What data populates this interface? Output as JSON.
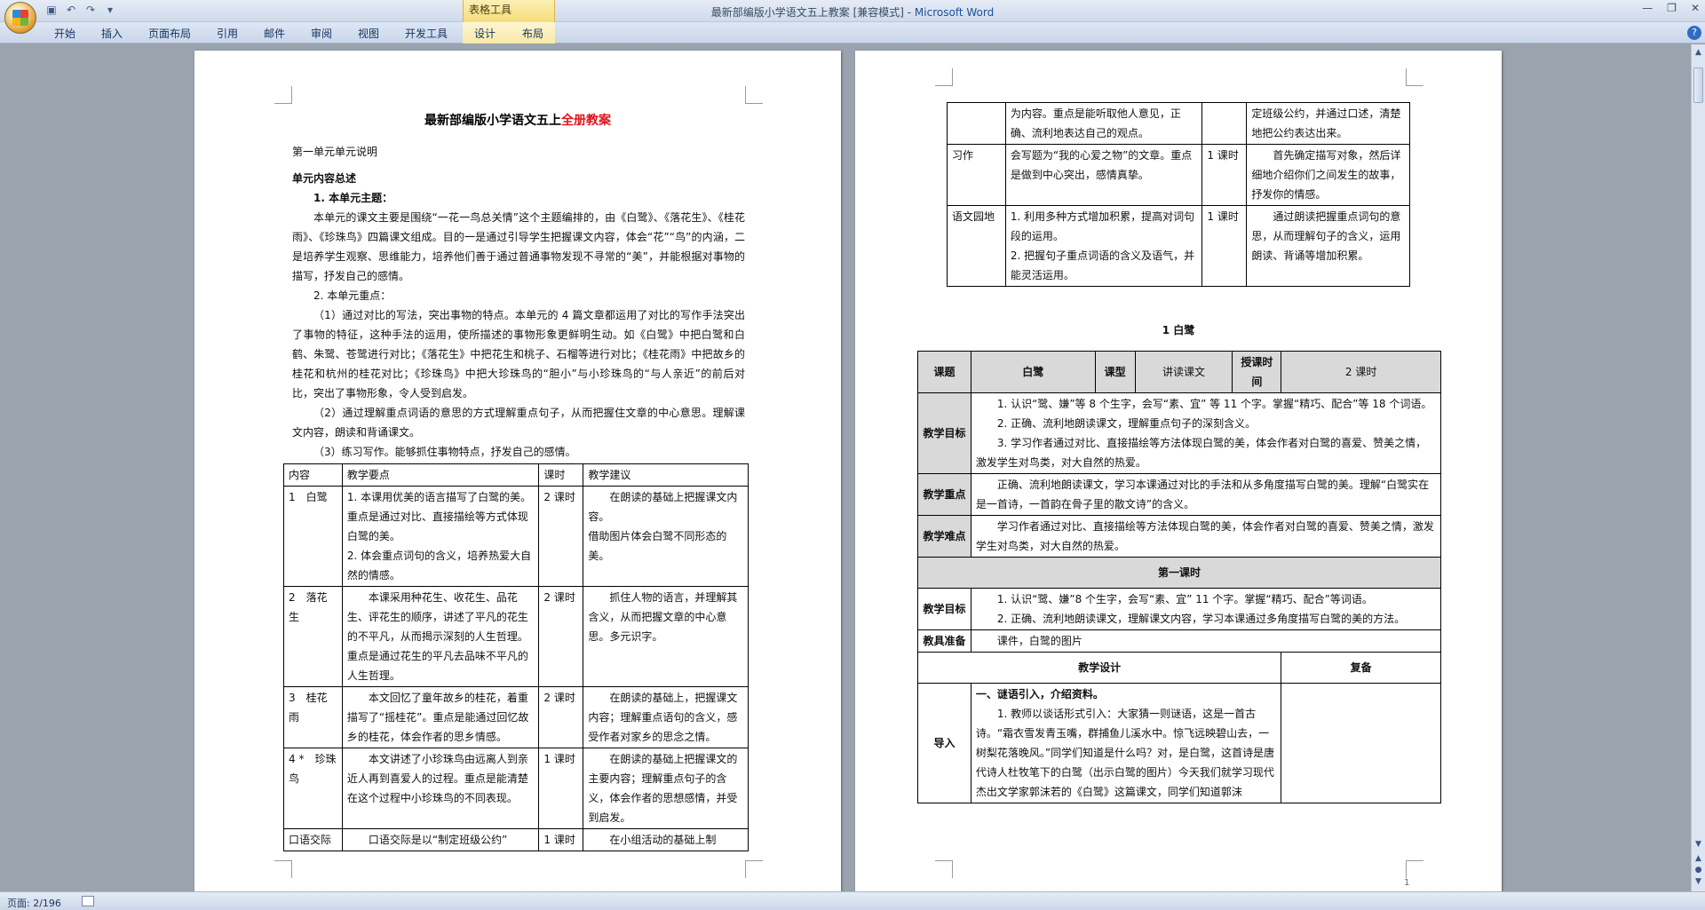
{
  "window": {
    "title_left": "最新部编版小学语文五上教案 [兼容模式] - ",
    "title_brand": "Microsoft Word",
    "context_tab_group": "表格工具"
  },
  "ribbon": {
    "tabs": [
      "开始",
      "插入",
      "页面布局",
      "引用",
      "邮件",
      "审阅",
      "视图",
      "开发工具",
      "设计",
      "布局"
    ]
  },
  "status": {
    "page": "页面: 2/196"
  },
  "page1": {
    "title_main": "最新部编版小学语文五上",
    "title_red": "全册教案",
    "unit_label": "第一单元单元说明",
    "overview_heading": "单元内容总述",
    "theme_heading": "1. 本单元主题：",
    "theme_text": "本单元的课文主要是围绕“一花一鸟总关情”这个主题编排的，由《白鹭》、《落花生》、《桂花雨》、《珍珠鸟》四篇课文组成。目的一是通过引导学生把握课文内容，体会“花”“鸟”的内涵，二是培养学生观察、思维能力，培养他们善于通过普通事物发现不寻常的“美”，并能根据对事物的描写，抒发自己的感情。",
    "focus_heading": "2. 本单元重点：",
    "focus_1": "（1）通过对比的写法，突出事物的特点。本单元的 4 篇文章都运用了对比的写作手法突出了事物的特征，这种手法的运用，使所描述的事物形象更鲜明生动。如《白鹭》中把白鹭和白鹤、朱鹭、苍鹭进行对比；《落花生》中把花生和桃子、石榴等进行对比；《桂花雨》中把故乡的桂花和杭州的桂花对比；《珍珠鸟》中把大珍珠鸟的“胆小”与小珍珠鸟的“与人亲近”的前后对比，突出了事物形象，令人受到启发。",
    "focus_2": "（2）通过理解重点词语的意思的方式理解重点句子，从而把握住文章的中心意思。理解课文内容，朗读和背诵课文。",
    "focus_3": "（3）练习写作。能够抓住事物特点，抒发自己的感情。",
    "table_headers": [
      "内容",
      "教学要点",
      "课时",
      "教学建议"
    ],
    "table_rows": [
      {
        "content": "1　白鹭",
        "points": "1. 本课用优美的语言描写了白鹭的美。重点是通过对比、直接描绘等方式体现白鹭的美。\n2. 体会重点词句的含义，培养热爱大自然的情感。",
        "hours": "2 课时",
        "advice": "在朗读的基础上把握课文内容。\n借助图片体会白鹭不同形态的美。"
      },
      {
        "content": "2　落花生",
        "points": "本课采用种花生、收花生、品花生、评花生的顺序，讲述了平凡的花生的不平凡，从而揭示深刻的人生哲理。重点是通过花生的平凡去品味不平凡的人生哲理。",
        "hours": "2 课时",
        "advice": "抓住人物的语言，并理解其含义，从而把握文章的中心意思。多元识字。"
      },
      {
        "content": "3　桂花雨",
        "points": "本文回忆了童年故乡的桂花，着重描写了“摇桂花”。重点是能通过回忆故乡的桂花，体会作者的思乡情感。",
        "hours": "2 课时",
        "advice": "在朗读的基础上，把握课文内容；理解重点语句的含义，感受作者对家乡的思念之情。"
      },
      {
        "content": "4 *　珍珠鸟",
        "points": "本文讲述了小珍珠鸟由远离人到亲近人再到喜爱人的过程。重点是能清楚在这个过程中小珍珠鸟的不同表现。",
        "hours": "1 课时",
        "advice": "在朗读的基础上把握课文的主要内容；理解重点句子的含义，体会作者的思想感情，并受到启发。"
      },
      {
        "content": "口语交际",
        "points": "口语交际是以“制定班级公约”",
        "hours": "1 课时",
        "advice": "在小组活动的基础上制"
      }
    ]
  },
  "page2": {
    "top_table": [
      {
        "content": "",
        "points": "为内容。重点是能听取他人意见，正确、流利地表达自己的观点。",
        "hours": "",
        "advice": "定班级公约，并通过口述，清楚地把公约表达出来。"
      },
      {
        "content": "习作",
        "points": "会写题为“我的心爱之物”的文章。重点是做到中心突出，感情真挚。",
        "hours": "1 课时",
        "advice": "首先确定描写对象，然后详细地介绍你们之间发生的故事，抒发你的情感。"
      },
      {
        "content": "语文园地",
        "points": "1. 利用多种方式增加积累，提高对词句段的运用。\n2. 把握句子重点词语的含义及语气，并能灵活运用。",
        "hours": "1 课时",
        "advice": "通过朗读把握重点词句的意思，从而理解句子的含义，运用朗读、背诵等增加积累。"
      }
    ],
    "lesson_title": "1 白鹭",
    "lesson": {
      "topic_label": "课题",
      "topic": "白鹭",
      "type_label": "课型",
      "type": "讲读课文",
      "time_label": "授课时间",
      "hours": "2 课时",
      "goals_label": "教学目标",
      "goals": [
        "1. 认识“鹭、嫌”等 8 个生字，会写“素、宜” 等 11 个字。掌握“精巧、配合”等 18 个词语。",
        "2. 正确、流利地朗读课文，理解重点句子的深刻含义。",
        "3. 学习作者通过对比、直接描绘等方法体现白鹭的美，体会作者对白鹭的喜爱、赞美之情，激发学生对鸟类，对大自然的热爱。"
      ],
      "focus_label": "教学重点",
      "focus": "正确、流利地朗读课文，学习本课通过对比的手法和从多角度描写白鹭的美。理解“白鹭实在是一首诗，一首韵在骨子里的散文诗”的含义。",
      "difficulty_label": "教学难点",
      "difficulty": "学习作者通过对比、直接描绘等方法体现白鹭的美，体会作者对白鹭的喜爱、赞美之情，激发学生对鸟类，对大自然的热爱。",
      "period1": "第一课时",
      "p1_goals_label": "教学目标",
      "p1_goals": [
        "1. 认识“鹭、嫌”8 个生字，会写“素、宜” 11 个字。掌握“精巧、配合”等词语。",
        "2. 正确、流利地朗读课文，理解课文内容，学习本课通过多角度描写白鹭的美的方法。"
      ],
      "prep_label": "教具准备",
      "prep": "课件，白鹭的图片",
      "design_label": "教学设计",
      "backup_label": "复备",
      "intro_label": "导入",
      "intro_heading": "一、谜语引入，介绍资料。",
      "intro_text": "1. 教师以谈话形式引入：大家猜一则谜语，这是一首古诗。“霜衣雪发青玉嘴，群捕鱼儿溪水中。惊飞远映碧山去，一树梨花落晚风。”同学们知道是什么吗？对，是白鹭，这首诗是唐代诗人杜牧笔下的白鹭（出示白鹭的图片）今天我们就学习现代杰出文学家郭沫若的《白鹭》这篇课文，同学们知道郭沫"
    },
    "page_number": "1"
  }
}
